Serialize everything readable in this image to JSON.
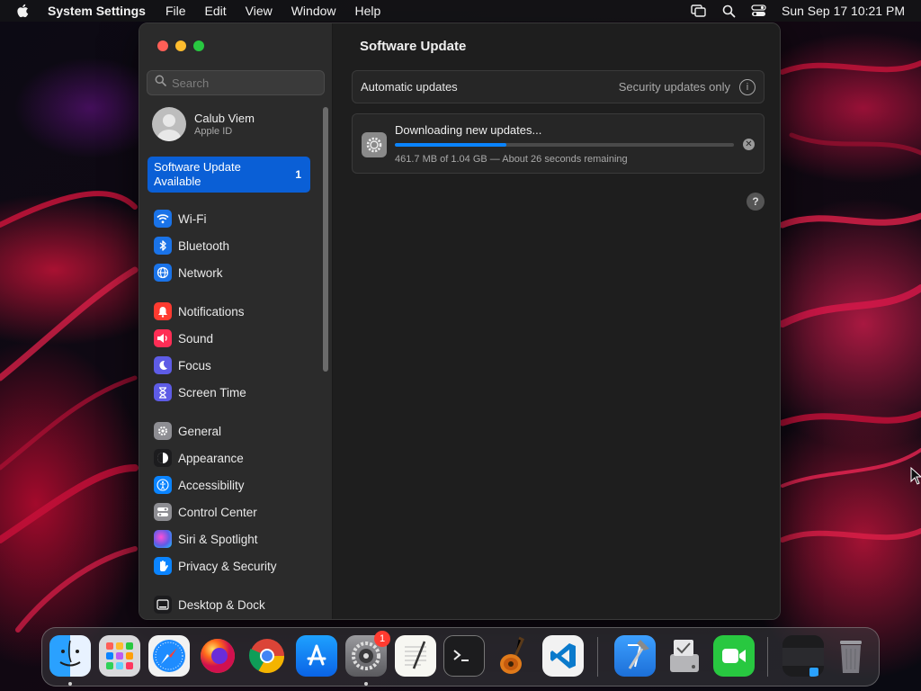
{
  "menubar": {
    "app_name": "System Settings",
    "menus": [
      "File",
      "Edit",
      "View",
      "Window",
      "Help"
    ],
    "clock": "Sun Sep 17  10:21 PM",
    "icons": [
      "apple-icon",
      "screen-mirroring-icon",
      "spotlight-search-icon",
      "control-center-icon"
    ]
  },
  "sidebar": {
    "search_placeholder": "Search",
    "account": {
      "name": "Calub Viem",
      "subtitle": "Apple ID"
    },
    "update_item": {
      "label": "Software Update Available",
      "count": "1"
    },
    "items": [
      {
        "label": "Wi-Fi",
        "icon": "wifi-icon",
        "color": "#1a73e8"
      },
      {
        "label": "Bluetooth",
        "icon": "bluetooth-icon",
        "color": "#1a73e8"
      },
      {
        "label": "Network",
        "icon": "globe-icon",
        "color": "#1a73e8"
      },
      {
        "label": "Notifications",
        "icon": "bell-icon",
        "color": "#ff3b30"
      },
      {
        "label": "Sound",
        "icon": "speaker-icon",
        "color": "#ff2d55"
      },
      {
        "label": "Focus",
        "icon": "moon-icon",
        "color": "#5e5ce6"
      },
      {
        "label": "Screen Time",
        "icon": "hourglass-icon",
        "color": "#5e5ce6"
      },
      {
        "label": "General",
        "icon": "gear-icon",
        "color": "#8e8e93"
      },
      {
        "label": "Appearance",
        "icon": "appearance-icon",
        "color": "#1c1c1e"
      },
      {
        "label": "Accessibility",
        "icon": "accessibility-icon",
        "color": "#0a84ff"
      },
      {
        "label": "Control Center",
        "icon": "control-center-icon",
        "color": "#8e8e93"
      },
      {
        "label": "Siri & Spotlight",
        "icon": "siri-icon",
        "color": "#bf5af2"
      },
      {
        "label": "Privacy & Security",
        "icon": "hand-icon",
        "color": "#0a84ff"
      },
      {
        "label": "Desktop & Dock",
        "icon": "desktop-icon",
        "color": "#1c1c1e"
      }
    ]
  },
  "main": {
    "title": "Software Update",
    "automatic_updates": {
      "label": "Automatic updates",
      "value": "Security updates only"
    },
    "download": {
      "heading": "Downloading new updates...",
      "status": "461.7 MB of 1.04 GB — About 26 seconds remaining",
      "progress_fraction": 0.33
    },
    "help_label": "?"
  },
  "dock": {
    "badge": "1",
    "apps": [
      "Finder",
      "Launchpad",
      "Safari",
      "Firefox",
      "Chrome",
      "App Store",
      "System Settings",
      "TextEdit",
      "Terminal",
      "GarageBand",
      "Visual Studio Code",
      "Xcode",
      "Disk Utility",
      "FaceTime",
      "Downloads",
      "Trash"
    ]
  }
}
